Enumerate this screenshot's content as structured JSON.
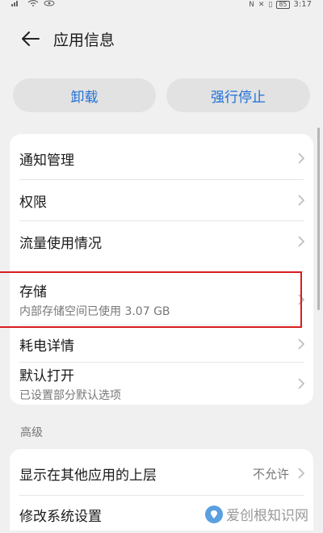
{
  "status_bar": {
    "time": "3:17",
    "battery": "85"
  },
  "header": {
    "title": "应用信息"
  },
  "actions": {
    "uninstall_label": "卸载",
    "force_stop_label": "强行停止"
  },
  "settings": {
    "items": [
      {
        "label": "通知管理"
      },
      {
        "label": "权限"
      },
      {
        "label": "流量使用情况"
      },
      {
        "label": "存储",
        "subtitle": "内部存储空间已使用 3.07 GB"
      },
      {
        "label": "耗电详情"
      },
      {
        "label": "默认打开",
        "subtitle": "已设置部分默认选项"
      }
    ]
  },
  "advanced": {
    "header": "高级",
    "items": [
      {
        "label": "显示在其他应用的上层",
        "value": "不允许"
      },
      {
        "label": "修改系统设置"
      }
    ]
  },
  "watermark": {
    "text": "爱创根知识网"
  },
  "colors": {
    "accent": "#1f6fd6",
    "highlight": "#d81e1e",
    "background": "#f0f0f0"
  }
}
